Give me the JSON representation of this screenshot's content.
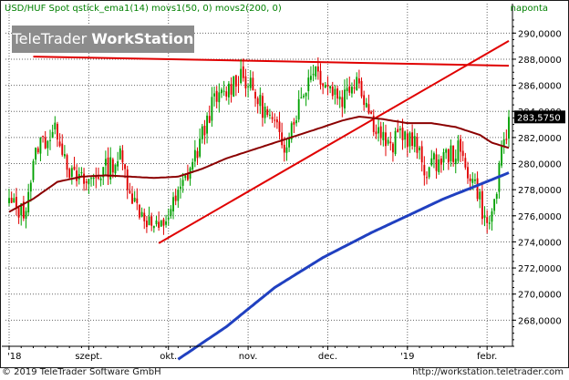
{
  "header": {
    "title": "USD/HUF Spot qstick_ema1(14) movs1(50, 0) movs2(200, 0)",
    "period": "naponta"
  },
  "logo": {
    "part1": "TeleTrader ",
    "part2": "WorkStation"
  },
  "footer": {
    "copyright": "© 2019 TeleTrader Software GmbH",
    "url": "http://workstation.teletrader.com"
  },
  "colors": {
    "up": "#00a000",
    "down": "#e00000",
    "ma50": "#8b0000",
    "ma200": "#2040c0",
    "trendlines": "#e00000",
    "grid": "#666666",
    "last_price_box": "#000000"
  },
  "chart_data": {
    "type": "candlestick",
    "instrument": "USD/HUF Spot",
    "ylim": [
      266.0,
      291.0
    ],
    "y_ticks": [
      268.0,
      270.0,
      272.0,
      274.0,
      276.0,
      278.0,
      280.0,
      282.0,
      284.0,
      286.0,
      288.0,
      290.0
    ],
    "y_tick_labels": [
      "268,0000",
      "270,0000",
      "272,0000",
      "274,0000",
      "276,0000",
      "278,0000",
      "280,0000",
      "282,0000",
      "284,0000",
      "286,0000",
      "288,0000",
      "290,0000"
    ],
    "x_tick_labels": [
      "'18",
      "szept.",
      "okt.",
      "nov.",
      "dec.",
      "'19",
      "febr."
    ],
    "x_tick_index": [
      0,
      33,
      66,
      99,
      132,
      165,
      198
    ],
    "n_candles": 208,
    "last_price": 283.575,
    "last_price_label": "283,5750",
    "close_anchors": [
      [
        0,
        277.0
      ],
      [
        6,
        276.2
      ],
      [
        12,
        281.5
      ],
      [
        20,
        282.5
      ],
      [
        26,
        279.0
      ],
      [
        32,
        278.5
      ],
      [
        40,
        279.6
      ],
      [
        46,
        280.5
      ],
      [
        52,
        277.0
      ],
      [
        58,
        275.5
      ],
      [
        62,
        274.8
      ],
      [
        70,
        277.5
      ],
      [
        78,
        281.0
      ],
      [
        84,
        284.5
      ],
      [
        90,
        285.5
      ],
      [
        96,
        287.0
      ],
      [
        100,
        285.8
      ],
      [
        106,
        284.0
      ],
      [
        114,
        281.5
      ],
      [
        120,
        284.5
      ],
      [
        126,
        287.5
      ],
      [
        132,
        286.0
      ],
      [
        138,
        285.0
      ],
      [
        144,
        286.8
      ],
      [
        150,
        283.5
      ],
      [
        158,
        281.0
      ],
      [
        162,
        282.5
      ],
      [
        168,
        281.5
      ],
      [
        172,
        279.5
      ],
      [
        180,
        280.5
      ],
      [
        186,
        281.0
      ],
      [
        190,
        279.5
      ],
      [
        194,
        278.0
      ],
      [
        196,
        276.5
      ],
      [
        198,
        275.0
      ],
      [
        201,
        277.0
      ],
      [
        204,
        280.5
      ],
      [
        206,
        282.0
      ],
      [
        207,
        283.575
      ]
    ],
    "ma50_anchors": [
      [
        0,
        276.3
      ],
      [
        10,
        277.3
      ],
      [
        20,
        278.6
      ],
      [
        30,
        279.0
      ],
      [
        40,
        279.1
      ],
      [
        50,
        279.0
      ],
      [
        60,
        278.9
      ],
      [
        70,
        279.0
      ],
      [
        80,
        279.6
      ],
      [
        90,
        280.4
      ],
      [
        100,
        281.0
      ],
      [
        110,
        281.6
      ],
      [
        120,
        282.2
      ],
      [
        130,
        282.8
      ],
      [
        138,
        283.3
      ],
      [
        145,
        283.6
      ],
      [
        155,
        283.4
      ],
      [
        165,
        283.1
      ],
      [
        175,
        283.1
      ],
      [
        185,
        282.8
      ],
      [
        195,
        282.2
      ],
      [
        200,
        281.6
      ],
      [
        207,
        281.2
      ]
    ],
    "ma200_anchors": [
      [
        70,
        265.0
      ],
      [
        90,
        267.5
      ],
      [
        110,
        270.5
      ],
      [
        130,
        272.8
      ],
      [
        150,
        274.7
      ],
      [
        165,
        276.0
      ],
      [
        180,
        277.3
      ],
      [
        195,
        278.4
      ],
      [
        207,
        279.3
      ]
    ],
    "trendlines": [
      {
        "name": "resistance",
        "from": [
          10,
          288.2
        ],
        "to": [
          207,
          287.5
        ]
      },
      {
        "name": "support",
        "from": [
          62,
          273.9
        ],
        "to": [
          207,
          289.4
        ]
      }
    ]
  }
}
